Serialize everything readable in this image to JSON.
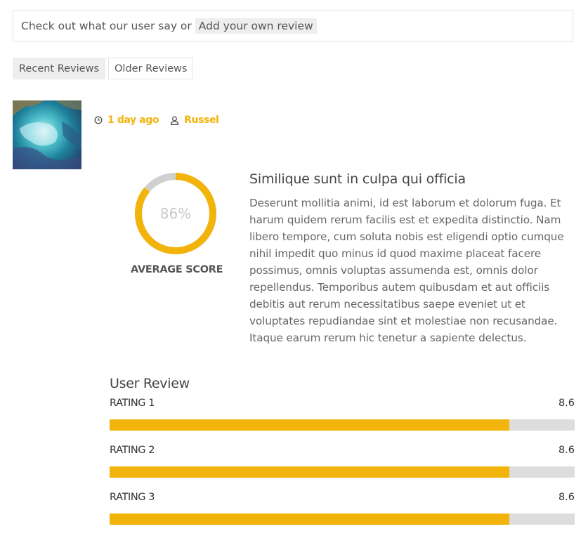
{
  "notice": {
    "text": "Check out what our user say or",
    "add_link": "Add your own review"
  },
  "tabs": [
    {
      "label": "Recent Reviews",
      "active": true
    },
    {
      "label": "Older Reviews",
      "active": false
    }
  ],
  "review": {
    "time_ago": "1 day ago",
    "author": "Russel",
    "title": "Similique sunt in culpa qui officia",
    "body": "Deserunt mollitia animi, id est laborum et dolorum fuga. Et harum quidem rerum facilis est et expedita distinctio. Nam libero tempore, cum soluta nobis est eligendi optio cumque nihil impedit quo minus id quod maxime placeat facere possimus, omnis voluptas assumenda est, omnis dolor repellendus. Temporibus autem quibusdam et aut officiis debitis aut rerum necessitatibus saepe eveniet ut et voluptates repudiandae sint et molestiae non recusandae. Itaque earum rerum hic tenetur a sapiente delectus.",
    "average_score_text": "86%",
    "average_score_value": 86,
    "average_score_label": "AVERAGE SCORE"
  },
  "user_review": {
    "heading": "User Review",
    "max_rating": 10,
    "ratings": [
      {
        "label": "RATING 1",
        "value": "8.6"
      },
      {
        "label": "RATING 2",
        "value": "8.6"
      },
      {
        "label": "RATING 3",
        "value": "8.6"
      }
    ]
  },
  "colors": {
    "accent": "#f2b40b",
    "track": "#dddddd",
    "ring_track": "#d0d0d0"
  },
  "icons": {
    "time": "clock-icon",
    "author": "user-icon"
  }
}
